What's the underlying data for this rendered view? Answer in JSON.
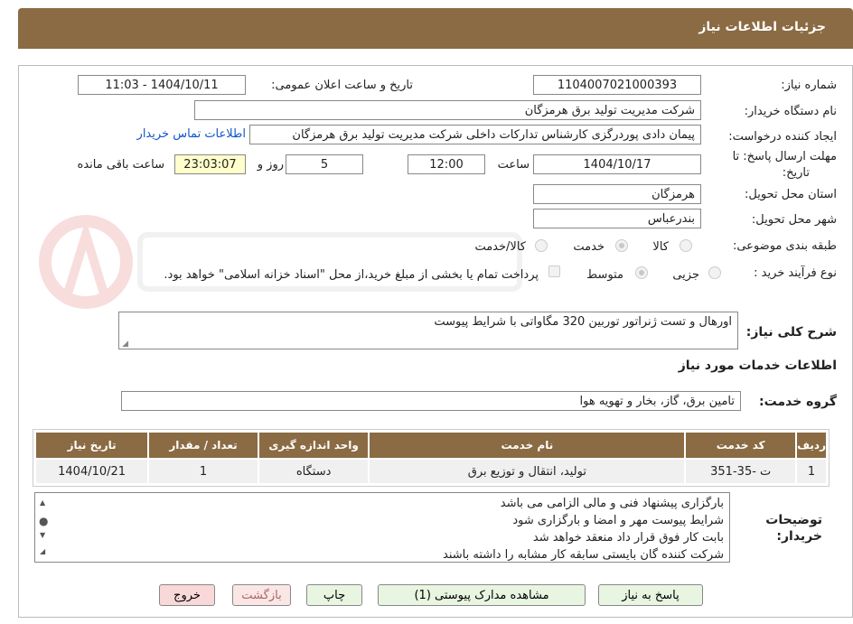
{
  "header": {
    "title": "جزئیات اطلاعات نیاز"
  },
  "form": {
    "need_number_label": "شماره نیاز:",
    "need_number": "1104007021000393",
    "announce_label": "تاریخ و ساعت اعلان عمومی:",
    "announce_value": "1404/10/11 - 11:03",
    "buyer_org_label": "نام دستگاه خریدار:",
    "buyer_org": "شرکت مدیریت تولید برق هرمزگان",
    "requester_label": "ایجاد کننده درخواست:",
    "requester": "پیمان دادی پوردرگزی کارشناس تدارکات داخلی شرکت مدیریت تولید برق هرمزگان",
    "contact_link": "اطلاعات تماس خریدار",
    "deadline_label_1": "مهلت ارسال پاسخ: تا",
    "deadline_label_2": "تاریخ:",
    "deadline_date": "1404/10/17",
    "time_label": "ساعت",
    "deadline_time": "12:00",
    "days_value": "5",
    "days_label": "روز و",
    "remaining_time": "23:03:07",
    "remaining_label": "ساعت باقی مانده",
    "province_label": "استان محل تحویل:",
    "province": "هرمزگان",
    "city_label": "شهر محل تحویل:",
    "city": "بندرعباس",
    "category_label": "طبقه بندی موضوعی:",
    "category_options": [
      "کالا",
      "خدمت",
      "کالا/خدمت"
    ],
    "process_label": "نوع فرآیند خرید :",
    "process_options": [
      "جزیی",
      "متوسط"
    ],
    "payment_note": "پرداخت تمام یا بخشی از مبلغ خرید،از محل \"اسناد خزانه اسلامی\" خواهد بود."
  },
  "description": {
    "label": "شرح کلی نیاز:",
    "text": "اورهال و تست ژنراتور توربین 320 مگاواتی با شرایط پیوست"
  },
  "services": {
    "section_title": "اطلاعات خدمات مورد نیاز",
    "group_label": "گروه خدمت:",
    "group_value": "تامین برق، گاز، بخار و تهویه هوا",
    "columns": [
      "ردیف",
      "کد خدمت",
      "نام خدمت",
      "واحد اندازه گیری",
      "تعداد / مقدار",
      "تاریخ نیاز"
    ],
    "rows": [
      [
        "1",
        "ت -35-351",
        "تولید، انتقال و توزیع برق",
        "دستگاه",
        "1",
        "1404/10/21"
      ]
    ]
  },
  "buyer_notes": {
    "label_1": "توضیحات",
    "label_2": "خریدار:",
    "lines": [
      "بارگزاری پیشنهاد فنی و مالی الزامی می باشد",
      "شرایط پیوست مهر و امضا و بارگزاری شود",
      "بابت کار فوق قرار داد منعقد خواهد شد",
      "شرکت کننده گان بایستی سابقه کار مشابه را داشته باشند"
    ]
  },
  "buttons": {
    "reply": "پاسخ به نیاز",
    "attachments": "مشاهده مدارک پیوستی (1)",
    "print": "چاپ",
    "back": "بازگشت",
    "exit": "خروج"
  },
  "colors": {
    "header_bg": "#8B6B43",
    "link": "#1155CC",
    "highlight": "#FFFFCC"
  }
}
